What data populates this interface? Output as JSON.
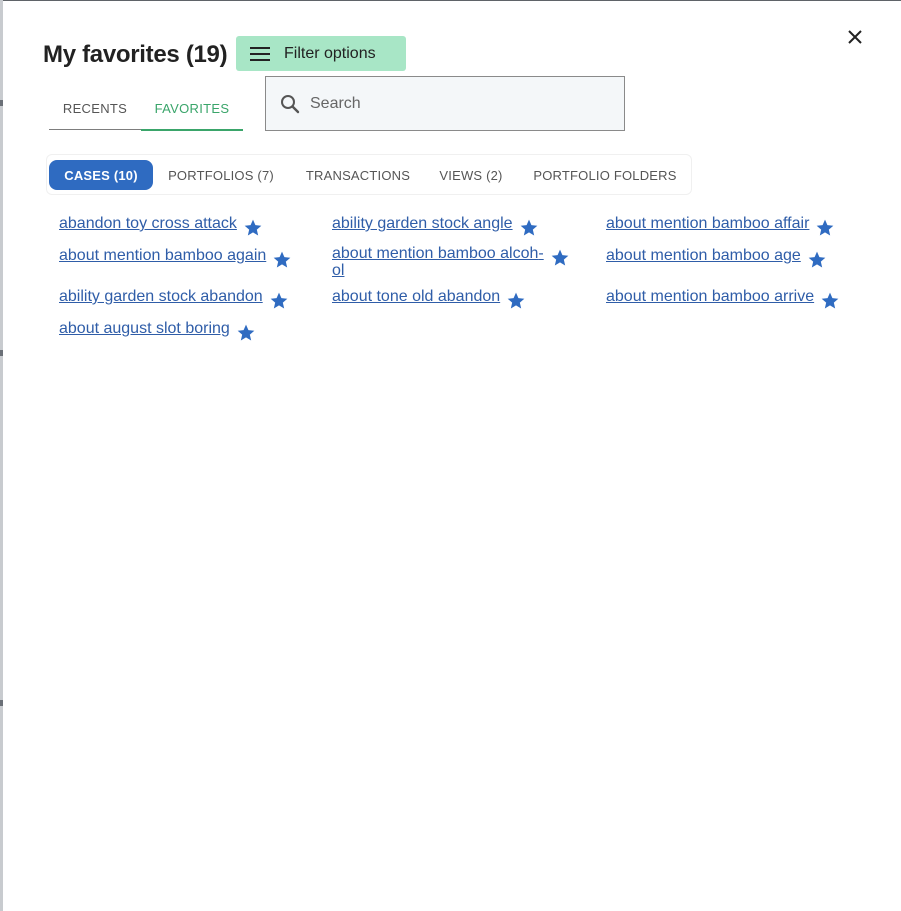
{
  "header": {
    "title": "My favorites (19)",
    "filter_label": "Filter options"
  },
  "tabs": [
    {
      "label": "RECENTS"
    },
    {
      "label": "FAVORITES"
    }
  ],
  "search": {
    "placeholder": "Search",
    "value": ""
  },
  "categories": [
    {
      "label": "CASES (10)"
    },
    {
      "label": "PORTFOLIOS (7)"
    },
    {
      "label": "TRANSACTIONS"
    },
    {
      "label": "VIEWS (2)"
    },
    {
      "label": "PORTFOLIO FOLDERS"
    }
  ],
  "favorites": [
    {
      "label": "abandon toy cross attack"
    },
    {
      "label": "ability garden stock angle"
    },
    {
      "label": "about mention bamboo affair"
    },
    {
      "label": "about mention bamboo again"
    },
    {
      "label": "about mention bamboo alcoh­ol"
    },
    {
      "label": "about mention bamboo age"
    },
    {
      "label": "ability garden stock abandon"
    },
    {
      "label": "about tone old abandon"
    },
    {
      "label": "about mention bamboo arrive"
    },
    {
      "label": "about august slot boring"
    }
  ],
  "colors": {
    "accent_green": "#3aa56a",
    "filter_bg": "#a8e6c6",
    "active_pill": "#2f6bc1",
    "link": "#2f5da8",
    "star": "#2f6bc1"
  },
  "icons": {
    "filter": "menu-icon",
    "close": "close-icon",
    "search": "search-icon",
    "favorite": "star-icon"
  }
}
